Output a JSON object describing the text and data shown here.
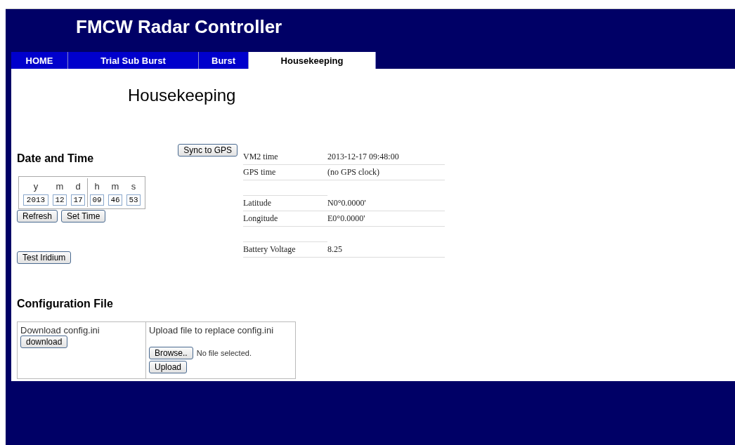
{
  "header": {
    "title": "FMCW Radar Controller"
  },
  "tabs": [
    {
      "label": "HOME",
      "selected": false
    },
    {
      "label": "Trial Sub Burst",
      "selected": false
    },
    {
      "label": "Burst",
      "selected": false
    },
    {
      "label": "Housekeeping",
      "selected": true
    }
  ],
  "page_title": "Housekeeping",
  "date_time": {
    "heading": "Date and Time",
    "columns": [
      "y",
      "m",
      "d",
      "h",
      "m",
      "s"
    ],
    "values": [
      "2013",
      "12",
      "17",
      "09",
      "46",
      "53"
    ],
    "buttons": [
      "Refresh",
      "Set Time"
    ]
  },
  "sync_button": "Sync to GPS",
  "info": [
    {
      "kind": "field",
      "label": "VM2 time",
      "value": "2013-12-17 09:48:00"
    },
    {
      "kind": "field",
      "label": "GPS time",
      "value": "(no GPS clock)"
    },
    {
      "kind": "spacer"
    },
    {
      "kind": "field",
      "label": "Latitude",
      "value": "N0°0.0000'"
    },
    {
      "kind": "field",
      "label": "Longitude",
      "value": "E0°0.0000'"
    },
    {
      "kind": "spacer"
    },
    {
      "kind": "field",
      "label": "Battery Voltage",
      "value": "8.25"
    }
  ],
  "iridium_button": "Test Iridium",
  "config": {
    "heading": "Configuration File",
    "download_label": "Download config.ini",
    "download_button": "download",
    "upload_label": "Upload file to replace config.ini",
    "browse_button": "Browse..",
    "file_status": "No file selected.",
    "upload_button": "Upload"
  }
}
